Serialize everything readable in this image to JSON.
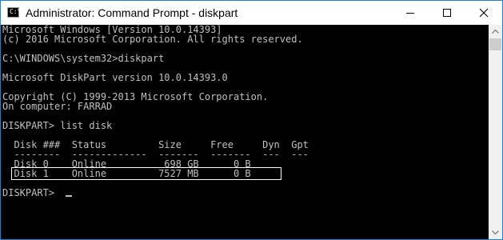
{
  "window": {
    "title": "Administrator: Command Prompt - diskpart",
    "icon": "command-prompt-icon",
    "icon_glyph": "C:\\",
    "controls": [
      "minimize",
      "maximize",
      "close"
    ]
  },
  "console": {
    "lines": [
      "Microsoft Windows [Version 10.0.14393]",
      "(c) 2016 Microsoft Corporation. All rights reserved.",
      "",
      "C:\\WINDOWS\\system32>diskpart",
      "",
      "Microsoft DiskPart version 10.0.14393.0",
      "",
      "Copyright (C) 1999-2013 Microsoft Corporation.",
      "On computer: FARRAD",
      "",
      "DISKPART> list disk",
      "",
      "  Disk ###  Status         Size     Free     Dyn  Gpt",
      "  --------  -------------  -------  -------  ---  ---",
      "  Disk 0    Online          698 GB      0 B",
      "  Disk 1    Online         7527 MB      0 B",
      "",
      "DISKPART> "
    ],
    "highlighted_row": "Disk 1",
    "text_color": "#c0c0c0",
    "background_color": "#000000"
  },
  "colors": {
    "title_bar": "#ffffff",
    "window_border": "#1883d7",
    "highlight_box": "#ffffff"
  }
}
